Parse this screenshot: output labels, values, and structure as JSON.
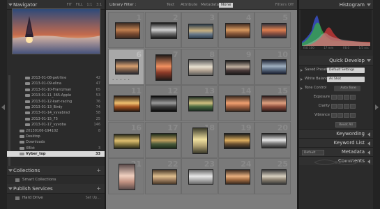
{
  "navigator": {
    "title": "Navigator",
    "zoom_options": [
      "FIT",
      "FILL",
      "1:1",
      "3:1"
    ]
  },
  "folders": [
    {
      "label": "2013-01-08-petrline",
      "count": "42"
    },
    {
      "label": "2013-01-09-elina",
      "count": "47"
    },
    {
      "label": "2013-01-10-Frantzman",
      "count": "65"
    },
    {
      "label": "2013-01-11_365-Apple",
      "count": "53"
    },
    {
      "label": "2013-01-12-kart-racing",
      "count": "76"
    },
    {
      "label": "2013-01-13_Birdy",
      "count": "74"
    },
    {
      "label": "2013-01-14_vyvabrad",
      "count": "58"
    },
    {
      "label": "2013-01-15_75",
      "count": "25"
    },
    {
      "label": "2013-01-17_vyvoba",
      "count": "146"
    },
    {
      "label": "20130106-194102",
      "count": "8",
      "top": true
    },
    {
      "label": "Desktop",
      "count": "",
      "top": true
    },
    {
      "label": "Downloads",
      "count": "",
      "top": true
    },
    {
      "label": "XBlst",
      "count": "3",
      "top": true
    },
    {
      "label": "Vyber_top",
      "count": "33",
      "top": true,
      "selected": true
    }
  ],
  "collections": {
    "title": "Collections",
    "items": [
      {
        "label": "Smart Collections"
      }
    ]
  },
  "publish": {
    "title": "Publish Services",
    "items": [
      {
        "label": "Hard Drive",
        "action": "Set Up..."
      }
    ]
  },
  "filter_bar": {
    "title": "Library Filter :",
    "options": [
      "Text",
      "Attribute",
      "Metadata",
      "None"
    ],
    "active": "None",
    "filters_off": "Filters Off"
  },
  "grid": {
    "cells": [
      {
        "num": "1"
      },
      {
        "num": "2"
      },
      {
        "num": "3"
      },
      {
        "num": "4"
      },
      {
        "num": "5"
      },
      {
        "num": "6",
        "selected": true
      },
      {
        "num": "7"
      },
      {
        "num": "8"
      },
      {
        "num": "9"
      },
      {
        "num": "10"
      },
      {
        "num": "11"
      },
      {
        "num": "12"
      },
      {
        "num": "13"
      },
      {
        "num": "14"
      },
      {
        "num": "15"
      },
      {
        "num": "16"
      },
      {
        "num": "17"
      },
      {
        "num": "18"
      },
      {
        "num": "19"
      },
      {
        "num": "20"
      },
      {
        "num": "21"
      },
      {
        "num": "22"
      },
      {
        "num": "23"
      },
      {
        "num": "24"
      },
      {
        "num": "25"
      }
    ]
  },
  "histogram": {
    "title": "Histogram",
    "info": [
      "ISO 100",
      "17 mm",
      "f/8.0",
      "1/5 sec"
    ]
  },
  "quick_develop": {
    "title": "Quick Develop",
    "saved_preset_label": "Saved Preset",
    "saved_preset_value": "Default Settings",
    "white_balance_label": "White Balance",
    "white_balance_value": "As Shot",
    "tone_control_label": "Tone Control",
    "auto_tone": "Auto Tone",
    "exposure": "Exposure",
    "clarity": "Clarity",
    "vibrance": "Vibrance",
    "reset_all": "Reset All"
  },
  "right_sections": {
    "keywording": "Keywording",
    "keyword_list": "Keyword List",
    "metadata": "Metadata",
    "metadata_preset": "Default",
    "comments": "Comments"
  }
}
